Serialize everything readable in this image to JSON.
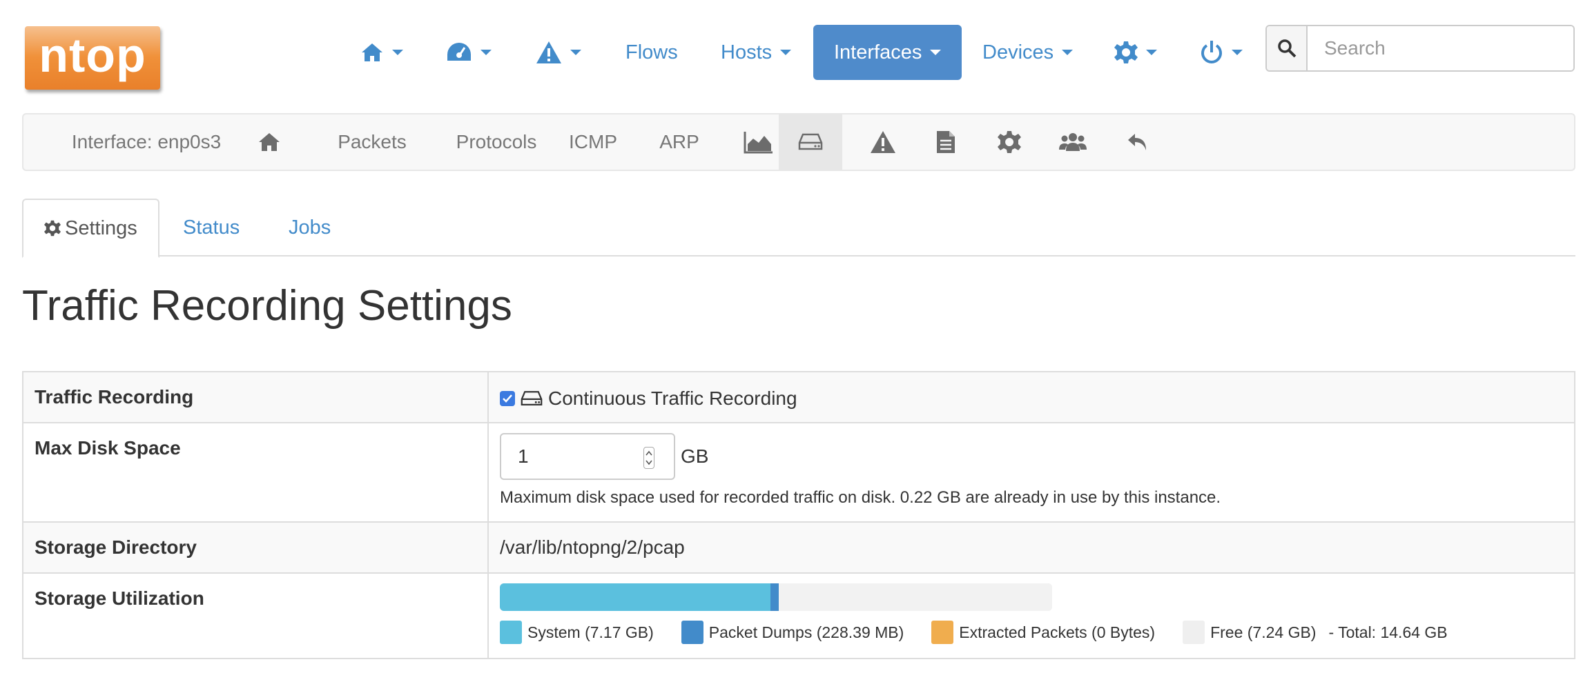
{
  "brand": {
    "logo_text": "ntop"
  },
  "navbar": {
    "home_icon": "home-icon",
    "dashboard_icon": "tachometer-icon",
    "alerts_icon": "warning-icon",
    "flows_label": "Flows",
    "hosts_label": "Hosts",
    "interfaces_label": "Interfaces",
    "devices_label": "Devices",
    "settings_icon": "gear-icon",
    "power_icon": "power-icon",
    "search_placeholder": "Search"
  },
  "interface_bar": {
    "interface_label": "Interface: enp0s3",
    "packets": "Packets",
    "protocols": "Protocols",
    "icmp": "ICMP",
    "arp": "ARP"
  },
  "tabs": {
    "settings": "Settings",
    "status": "Status",
    "jobs": "Jobs"
  },
  "page_title": "Traffic Recording Settings",
  "settings": {
    "traffic_recording": {
      "label": "Traffic Recording",
      "checkbox_checked": true,
      "checkbox_label": "Continuous Traffic Recording"
    },
    "max_disk_space": {
      "label": "Max Disk Space",
      "value": "1",
      "unit": "GB",
      "help": "Maximum disk space used for recorded traffic on disk. 0.22 GB are already in use by this instance."
    },
    "storage_directory": {
      "label": "Storage Directory",
      "value": "/var/lib/ntopng/2/pcap"
    },
    "storage_utilization": {
      "label": "Storage Utilization",
      "total_text": "-  Total: 14.64 GB",
      "segments": [
        {
          "name": "System (7.17 GB)",
          "fraction": 0.4897,
          "color": "#5bc0de"
        },
        {
          "name": "Packet Dumps (228.39 MB)",
          "fraction": 0.0152,
          "color": "#428bca"
        },
        {
          "name": "Extracted Packets (0 Bytes)",
          "fraction": 0.0,
          "color": "#f0ad4e"
        },
        {
          "name": "Free (7.24 GB)",
          "fraction": 0.4951,
          "color": "#f2f2f2"
        }
      ]
    }
  },
  "colors": {
    "link": "#428bca",
    "active_nav": "#4f8bcb",
    "logo_orange": "#f0913a"
  }
}
